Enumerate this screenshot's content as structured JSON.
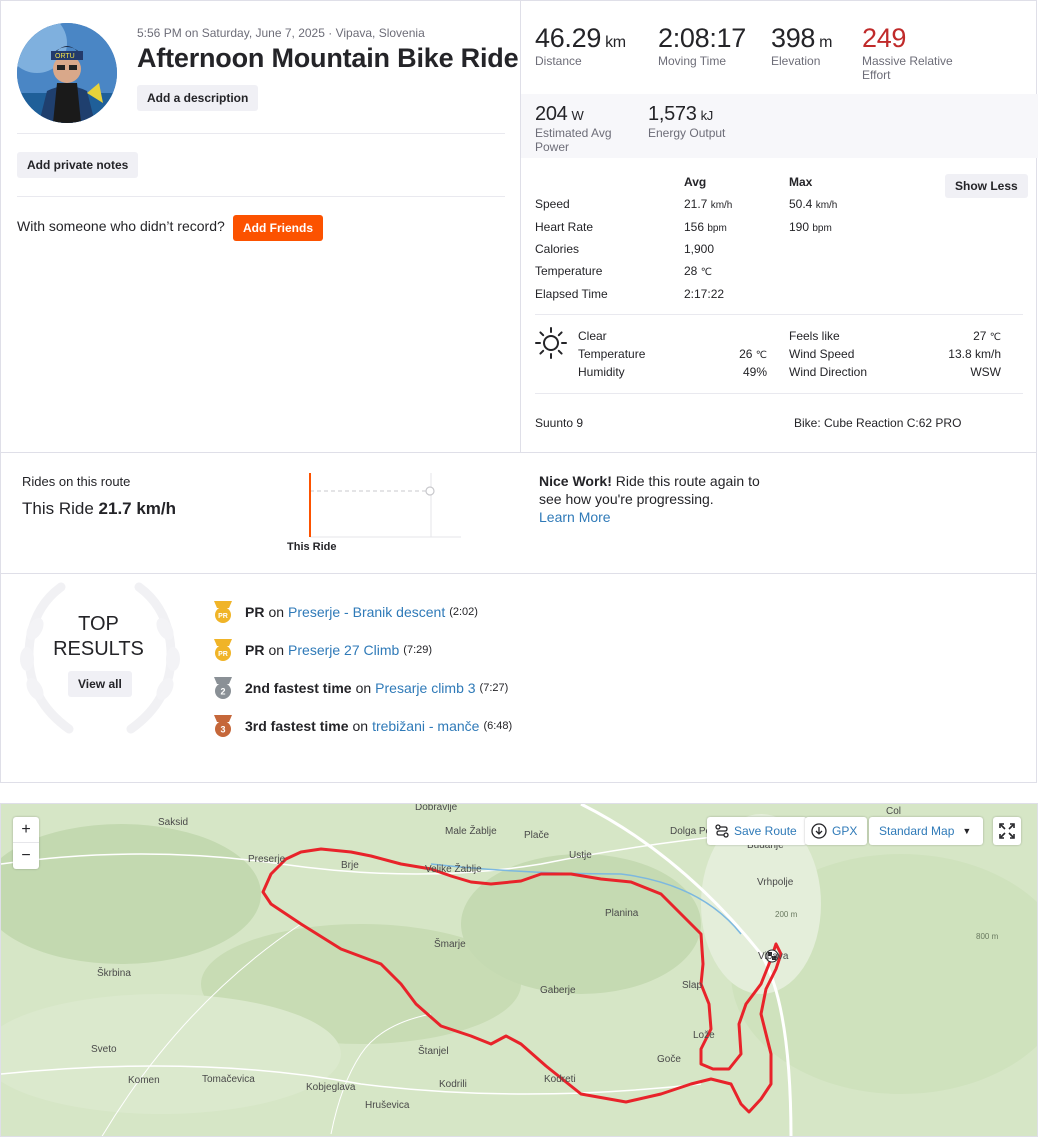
{
  "activity": {
    "meta": "5:56 PM on Saturday, June 7, 2025 · Vipava, Slovenia",
    "title": "Afternoon Mountain Bike Ride",
    "add_description": "Add a description",
    "add_private_notes": "Add private notes",
    "with_someone": "With someone who didn’t record?",
    "add_friends": "Add Friends"
  },
  "stats": {
    "distance": {
      "value": "46.29",
      "unit": "km",
      "label": "Distance"
    },
    "moving_time": {
      "value": "2:08:17",
      "label": "Moving Time"
    },
    "elevation": {
      "value": "398",
      "unit": "m",
      "label": "Elevation"
    },
    "relative_effort": {
      "value": "249",
      "label_1": "Massive Relative",
      "label_2": "Effort"
    },
    "power": {
      "value": "204",
      "unit": "W",
      "label_1": "Estimated Avg",
      "label_2": "Power"
    },
    "energy": {
      "value": "1,573",
      "unit": "kJ",
      "label": "Energy Output"
    }
  },
  "details": {
    "avg_header": "Avg",
    "max_header": "Max",
    "show_less": "Show Less",
    "rows": [
      {
        "label": "Speed",
        "avg": "21.7",
        "avg_unit": "km/h",
        "max": "50.4",
        "max_unit": "km/h"
      },
      {
        "label": "Heart Rate",
        "avg": "156",
        "avg_unit": "bpm",
        "max": "190",
        "max_unit": "bpm"
      },
      {
        "label": "Calories",
        "avg": "1,900",
        "avg_unit": "",
        "max": "",
        "max_unit": ""
      },
      {
        "label": "Temperature",
        "avg": "28",
        "avg_unit": "℃",
        "max": "",
        "max_unit": ""
      },
      {
        "label": "Elapsed Time",
        "avg": "2:17:22",
        "avg_unit": "",
        "max": "",
        "max_unit": ""
      }
    ]
  },
  "weather": {
    "condition": "Clear",
    "temperature_label": "Temperature",
    "temperature_value": "26",
    "temperature_unit": "℃",
    "humidity_label": "Humidity",
    "humidity_value": "49%",
    "feels_like_label": "Feels like",
    "feels_like_value": "27",
    "feels_like_unit": "℃",
    "wind_speed_label": "Wind Speed",
    "wind_speed_value": "13.8 km/h",
    "wind_dir_label": "Wind Direction",
    "wind_dir_value": "WSW"
  },
  "gear": {
    "device": "Suunto 9",
    "bike": "Bike: Cube Reaction C:62 PRO"
  },
  "route": {
    "title": "Rides on this route",
    "this_ride_prefix": "This Ride",
    "this_ride_value": "21.7 km/h",
    "chart_label": "This Ride",
    "nice_bold": "Nice Work!",
    "nice_text": "Ride this route again to see how you're progressing.",
    "learn_more": "Learn More"
  },
  "top_results": {
    "title_1": "TOP",
    "title_2": "RESULTS",
    "view_all": "View all",
    "items": [
      {
        "medal": "PR",
        "achievement": "PR",
        "segment": "Preserje - Branik descent",
        "time": "(2:02)",
        "color": "#f0b428"
      },
      {
        "medal": "PR",
        "achievement": "PR",
        "segment": "Preserje 27 Climb",
        "time": "(7:29)",
        "color": "#f0b428"
      },
      {
        "medal": "2",
        "achievement": "2nd fastest time",
        "segment": "Presarje climb 3",
        "time": "(7:27)",
        "color": "#8a9096"
      },
      {
        "medal": "3",
        "achievement": "3rd fastest time",
        "segment": "trebižani - manče",
        "time": "(6:48)",
        "color": "#c5673a"
      }
    ]
  },
  "map": {
    "zoom_in": "+",
    "zoom_out": "−",
    "save_route": "Save Route",
    "gpx": "GPX",
    "map_type": "Standard Map",
    "places": [
      "Dobravlje",
      "Saksid",
      "Male Žablje",
      "Plače",
      "Col",
      "Dolga Poljana",
      "Budanje",
      "Preserje",
      "Brje",
      "Ustje",
      "Velike Žablje",
      "Vrhpolje",
      "Planina",
      "Šmarje",
      "Škrbina",
      "Vipava",
      "Slap",
      "Gaberje",
      "800 m",
      "200 m",
      "Lože",
      "Sveto",
      "Štanjel",
      "Goče",
      "Komen",
      "Tomačevica",
      "Kobjeglava",
      "Kodrili",
      "Kodreti",
      "Hruševica"
    ]
  },
  "colors": {
    "brand": "#fc5200",
    "link": "#2f7ab8",
    "relative_effort": "#c02a2a",
    "route_line": "#e8232a"
  }
}
